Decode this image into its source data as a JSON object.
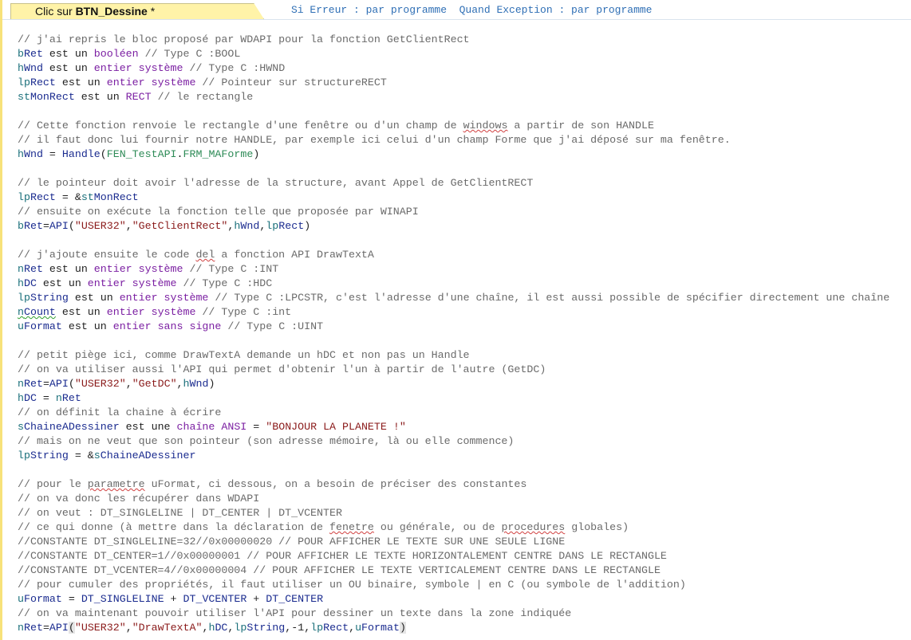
{
  "header": {
    "tab_prefix": "Clic sur ",
    "tab_name": "BTN_Dessine",
    "tab_suffix": " *",
    "error_info": "Si Erreur : par programme  Quand Exception : par programme"
  },
  "code": {
    "l01": "// j'ai repris le bloc proposé par WDAPI pour la fonction GetClientRect",
    "l02": [
      "b",
      "Ret",
      " est un ",
      "booléen",
      " // Type C :BOOL"
    ],
    "l03": [
      "h",
      "Wnd",
      " est un ",
      "entier système",
      " // Type C :HWND"
    ],
    "l04": [
      "lp",
      "Rect",
      " est un ",
      "entier système",
      " // Pointeur sur structureRECT"
    ],
    "l05": [
      "st",
      "MonRect",
      " est un ",
      "RECT",
      " // le rectangle"
    ],
    "l07a": "// Cette fonction renvoie le rectangle d'une fenêtre ou d'un champ de ",
    "l07b": "windows",
    "l07c": " a partir de son HANDLE",
    "l08": "// il faut donc lui fournir notre HANDLE, par exemple ici celui d'un champ Forme que j'ai déposé sur ma fenêtre.",
    "l09": [
      "h",
      "Wnd",
      " = ",
      "Handle",
      "(",
      "FEN_TestAPI",
      ".",
      "FRM_",
      "MAForme",
      ")"
    ],
    "l11": "// le pointeur doit avoir l'adresse de la structure, avant Appel de GetClientRECT",
    "l12": [
      "lp",
      "Rect",
      " = &",
      "st",
      "MonRect"
    ],
    "l13": "// ensuite on exécute la fonction telle que proposée par WINAPI",
    "l14": [
      "b",
      "Ret",
      "=",
      "API",
      "(",
      "\"USER32\"",
      ",",
      "\"GetClientRect\"",
      ",",
      "h",
      "Wnd",
      ",",
      "lp",
      "Rect",
      ")"
    ],
    "l16a": "// j'ajoute ensuite le code ",
    "l16b": "del",
    "l16c": " a fonction API DrawTextA",
    "l17": [
      "n",
      "Ret",
      " est un ",
      "entier système",
      " // Type C :INT"
    ],
    "l18": [
      "h",
      "DC",
      " est un ",
      "entier système",
      " // Type C :HDC"
    ],
    "l19": [
      "lp",
      "String",
      " est un ",
      "entier système",
      " // Type C :LPCSTR, c'est l'adresse d'une chaîne, il est aussi possible de spécifier directement une chaîne"
    ],
    "l20": [
      "n",
      "Count",
      " est un ",
      "entier système",
      " // Type C :int"
    ],
    "l21": [
      "u",
      "Format",
      " est un ",
      "entier sans signe",
      " // Type C :UINT"
    ],
    "l23": "// petit piège ici, comme DrawTextA demande un hDC et non pas un Handle",
    "l24": "// on va utiliser aussi l'API qui permet d'obtenir l'un à partir de l'autre (GetDC)",
    "l25": [
      "n",
      "Ret",
      "=",
      "API",
      "(",
      "\"USER32\"",
      ",",
      "\"GetDC\"",
      ",",
      "h",
      "Wnd",
      ")"
    ],
    "l26": [
      "h",
      "DC",
      " = ",
      "n",
      "Ret"
    ],
    "l27": "// on définit la chaine à écrire",
    "l28": [
      "s",
      "ChaineADessiner",
      " est une ",
      "chaîne ANSI",
      " = ",
      "\"BONJOUR LA PLANETE !\""
    ],
    "l29": "// mais on ne veut que son pointeur (son adresse mémoire, là ou elle commence)",
    "l30": [
      "lp",
      "String",
      " = &",
      "s",
      "ChaineADessiner"
    ],
    "l32a": "// pour le ",
    "l32b": "parametre",
    "l32c": " uFormat, ci dessous, on a besoin de préciser des constantes",
    "l33": "// on va donc les récupérer dans WDAPI",
    "l34": "// on veut : DT_SINGLELINE | DT_CENTER | DT_VCENTER",
    "l35a": "// ce qui donne (à mettre dans la déclaration de ",
    "l35b": "fenetre",
    "l35c": " ou générale, ou de ",
    "l35d": "procedures",
    "l35e": " globales)",
    "l36": "//CONSTANTE DT_SINGLELINE=32//0x00000020 // POUR AFFICHER LE TEXTE SUR UNE SEULE LIGNE",
    "l37": "//CONSTANTE DT_CENTER=1//0x00000001 // POUR AFFICHER LE TEXTE HORIZONTALEMENT CENTRE DANS LE RECTANGLE",
    "l38": "//CONSTANTE DT_VCENTER=4//0x00000004 // POUR AFFICHER LE TEXTE VERTICALEMENT CENTRE DANS LE RECTANGLE",
    "l39": "// pour cumuler des propriétés, il faut utiliser un OU binaire, symbole | en C (ou symbole de l'addition)",
    "l40": [
      "u",
      "Format",
      " = ",
      "DT_SINGLELINE",
      " + ",
      "DT_VCENTER",
      " + ",
      "DT_CENTER"
    ],
    "l41": "// on va maintenant pouvoir utiliser l'API pour dessiner un texte dans la zone indiquée",
    "l42": [
      "n",
      "Ret",
      "=",
      "API",
      "(",
      "\"USER32\"",
      ",",
      "\"DrawTextA\"",
      ",",
      "h",
      "DC",
      ",",
      "lp",
      "String",
      ",",
      "-1",
      ",",
      "lp",
      "Rect",
      ",",
      "u",
      "Format",
      ")"
    ]
  }
}
